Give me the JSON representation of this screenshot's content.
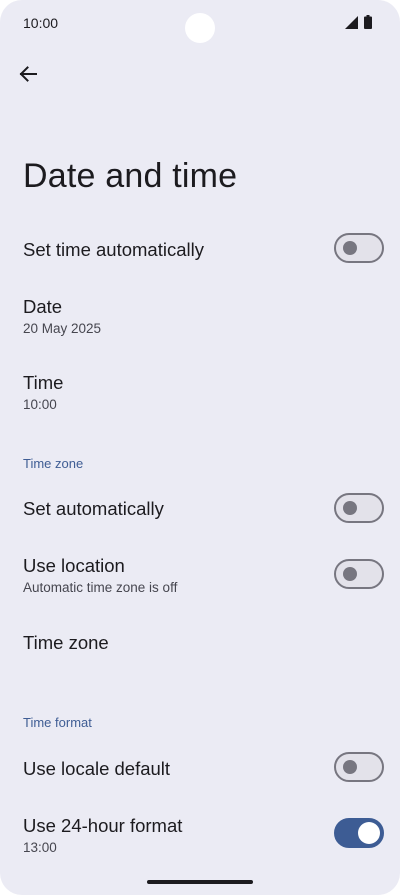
{
  "status_bar": {
    "time": "10:00",
    "icons": [
      "signal-icon",
      "battery-icon"
    ]
  },
  "header": {
    "back_icon": "arrow-back-icon",
    "title": "Date and time"
  },
  "settings": {
    "set_time_automatically": {
      "title": "Set time automatically",
      "enabled": false
    },
    "date": {
      "title": "Date",
      "value": "20 May 2025"
    },
    "time": {
      "title": "Time",
      "value": "10:00"
    }
  },
  "time_zone_section": {
    "header": "Time zone",
    "set_automatically": {
      "title": "Set automatically",
      "enabled": false
    },
    "use_location": {
      "title": "Use location",
      "subtitle": "Automatic time zone is off",
      "enabled": false
    },
    "time_zone": {
      "title": "Time zone"
    }
  },
  "time_format_section": {
    "header": "Time format",
    "use_locale_default": {
      "title": "Use locale default",
      "enabled": false
    },
    "use_24_hour": {
      "title": "Use 24-hour format",
      "subtitle": "13:00",
      "enabled": true
    }
  },
  "colors": {
    "background": "#ebebf4",
    "accent": "#3d5c94",
    "section_header": "#3f5d94",
    "toggle_off_outline": "#777680"
  }
}
